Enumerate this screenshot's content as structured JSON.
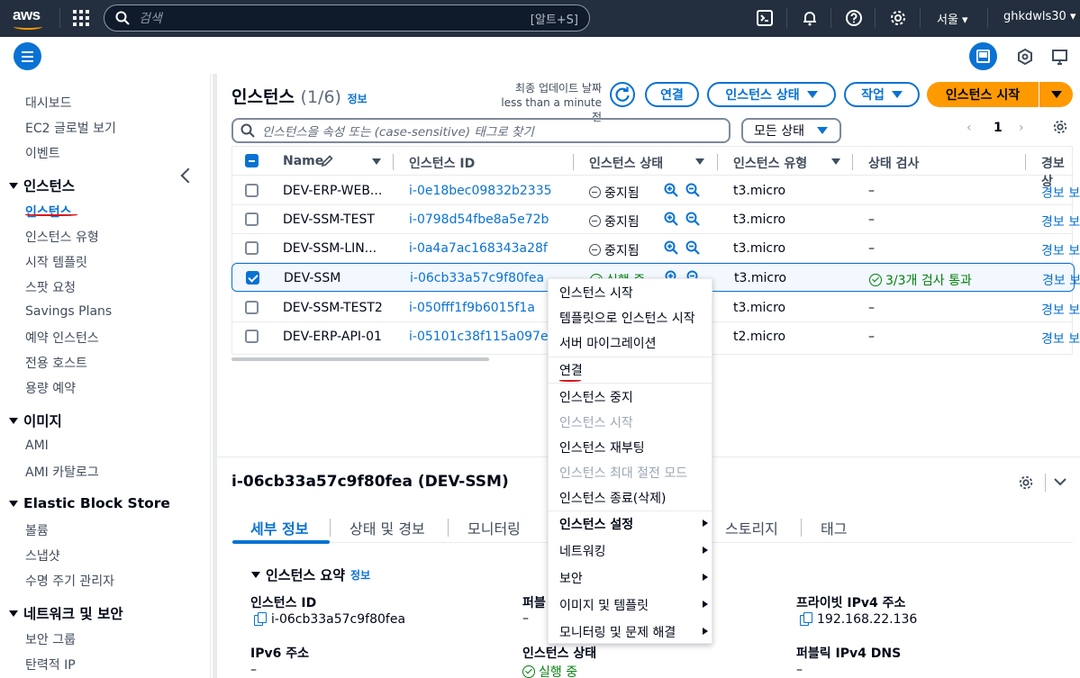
{
  "topbar": {
    "logo_text": "aws",
    "search_placeholder": "검색",
    "search_shortcut": "[알트+S]",
    "region": "서울 ▾",
    "user": "ghkdwls30 ▾"
  },
  "sidebar": {
    "items_top": [
      "대시보드",
      "EC2 글로벌 보기",
      "이벤트"
    ],
    "sections": [
      {
        "title": "인스턴스",
        "items": [
          "인스턴스",
          "인스턴스 유형",
          "시작 템플릿",
          "스팟 요청",
          "Savings Plans",
          "예약 인스턴스",
          "전용 호스트",
          "용량 예약"
        ]
      },
      {
        "title": "이미지",
        "items": [
          "AMI",
          "AMI 카탈로그"
        ]
      },
      {
        "title": "Elastic Block Store",
        "items": [
          "볼륨",
          "스냅샷",
          "수명 주기 관리자"
        ]
      },
      {
        "title": "네트워크 및 보안",
        "items": [
          "보안 그룹",
          "탄력적 IP"
        ]
      }
    ]
  },
  "header": {
    "title": "인스턴스",
    "count": "(1/6)",
    "info": "정보",
    "last_update_label": "최종 업데이트 날짜",
    "last_update_value": "less than a minute 전",
    "btn_connect": "연결",
    "btn_state": "인스턴스 상태",
    "btn_actions": "작업",
    "btn_launch": "인스턴스 시작"
  },
  "filter": {
    "placeholder": "인스턴스을 속성 또는 (case-sensitive) 태그로 찾기",
    "state_select": "모든 상태",
    "page": "1"
  },
  "table": {
    "columns": [
      "Name",
      "인스턴스 ID",
      "인스턴스 상태",
      "인스턴스 유형",
      "상태 검사",
      "경보 상"
    ],
    "rows": [
      {
        "name": "DEV-ERP-WEB...",
        "id": "i-0e18bec09832b2335",
        "state": "중지됨",
        "type": "t3.micro",
        "check": "–",
        "alarm": "경보 보"
      },
      {
        "name": "DEV-SSM-TEST",
        "id": "i-0798d54fbe8a5e72b",
        "state": "중지됨",
        "type": "t3.micro",
        "check": "–",
        "alarm": "경보 보"
      },
      {
        "name": "DEV-SSM-LIN...",
        "id": "i-0a4a7ac168343a28f",
        "state": "중지됨",
        "type": "t3.micro",
        "check": "–",
        "alarm": "경보 보"
      },
      {
        "name": "DEV-SSM",
        "id": "i-06cb33a57c9f80fea",
        "state": "실행 중",
        "type": "t3.micro",
        "check": "3/3개 검사 통과",
        "alarm": "경보 보"
      },
      {
        "name": "DEV-SSM-TEST2",
        "id": "i-050fff1f9b6015f1a",
        "state": "",
        "type": "t3.micro",
        "check": "–",
        "alarm": "경보 보"
      },
      {
        "name": "DEV-ERP-API-01",
        "id": "i-05101c38f115a097e",
        "state": "",
        "type": "t2.micro",
        "check": "–",
        "alarm": "경보 보"
      }
    ]
  },
  "context_menu": {
    "items": [
      "인스턴스 시작",
      "템플릿으로 인스턴스 시작",
      "서버 마이그레이션",
      "연결",
      "인스턴스 중지",
      "인스턴스 시작",
      "인스턴스 재부팅",
      "인스턴스 최대 절전 모드",
      "인스턴스 종료(삭제)",
      "인스턴스 설정",
      "네트워킹",
      "보안",
      "이미지 및 템플릿",
      "모니터링 및 문제 해결"
    ]
  },
  "detail": {
    "title": "i-06cb33a57c9f80fea (DEV-SSM)",
    "tabs": [
      "세부 정보",
      "상태 및 경보",
      "모니터링",
      "스토리지",
      "태그"
    ],
    "summary_title": "인스턴스 요약",
    "summary_info": "정보",
    "fields": {
      "instance_id_label": "인스턴스 ID",
      "instance_id_value": "i-06cb33a57c9f80fea",
      "public_label": "퍼블",
      "public_value": "–",
      "private_ip_label": "프라이빗 IPv4 주소",
      "private_ip_value": "192.168.22.136",
      "ipv6_label": "IPv6 주소",
      "ipv6_value": "–",
      "state_label": "인스턴스 상태",
      "state_value": "실행 중",
      "public_dns_label": "퍼블릭 IPv4 DNS",
      "public_dns_value": "–"
    }
  },
  "colors": {
    "accent": "#0972d3",
    "primary_button": "#ff9900",
    "topbar": "#232f3e",
    "success": "#037f0c",
    "annotation": "#d91515"
  }
}
